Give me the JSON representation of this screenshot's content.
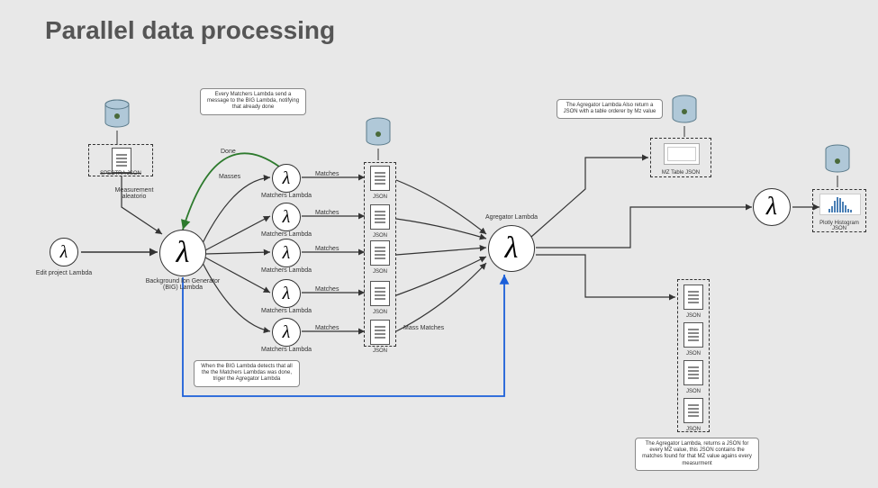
{
  "title": "Parallel data processing",
  "nodes": {
    "edit_lambda": "Edit project Lambda",
    "big_lambda": "Background Ion Generator (BIG) Lambda",
    "matchers": [
      "Matchers Lambda",
      "Matchers Lambda",
      "Matchers Lambda",
      "Matchers Lambda",
      "Matchers Lambda"
    ],
    "agregator": "Agregator Lambda",
    "spectra_json": "SPECTRA JSON",
    "json_docs": [
      "JSON",
      "JSON",
      "JSON",
      "JSON",
      "JSON"
    ],
    "json_out_docs": [
      "JSON",
      "JSON",
      "JSON",
      "JSON"
    ],
    "mz_table": "MZ Table JSON",
    "plotly_histogram": "Plotly Histogram JSON"
  },
  "edge_labels": {
    "measurement": "Measurement aleatorio",
    "done": "Done",
    "masses": "Masses",
    "matches": "Matches",
    "mass_matches": "Mass Matches"
  },
  "notes": {
    "top": "Every Matchers Lambda send a message to the BIG Lambda, notifying that already done",
    "bottom_left": "When the BIG Lambda detects that all the the Matchers Lambdas was done, triger the Agregator Lambda",
    "top_right": "The Agregator Lambda Also return a JSON with a table orderer by Mz value",
    "bottom_right": "The Agregator Lambda, returns a JSON for every MZ value, this JSON contains the matches found for that MZ value agains every measurment"
  }
}
